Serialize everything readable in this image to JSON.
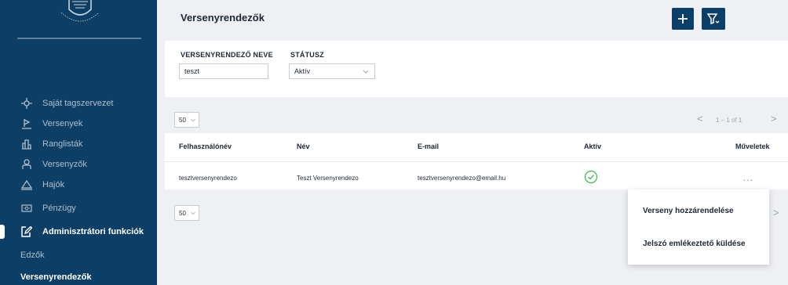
{
  "sidebar": {
    "logo_icon": "club-crest-logo",
    "items": [
      {
        "label": "Saját tagszervezet",
        "icon": "crosshair-icon"
      },
      {
        "label": "Versenyek",
        "icon": "flag-icon"
      },
      {
        "label": "Ranglisták",
        "icon": "bar-chart-icon"
      },
      {
        "label": "Versenyzők",
        "icon": "person-icon"
      },
      {
        "label": "Hajók",
        "icon": "boat-icon"
      },
      {
        "label": "Pénzügy",
        "icon": "wallet-icon"
      },
      {
        "label": "Adminisztrátori funkciók",
        "icon": "edit-icon"
      }
    ],
    "sub_items": [
      {
        "label": "Edzők"
      },
      {
        "label": "Versenyrendezők"
      }
    ]
  },
  "header": {
    "title": "Versenyrendezők",
    "add_icon": "plus-icon",
    "filter_icon": "filter-icon"
  },
  "filters": {
    "name_label": "VERSENYRENDEZŐ NEVE",
    "name_value": "teszt",
    "status_label": "STÁTUSZ",
    "status_value": "Aktív"
  },
  "pagination": {
    "page_size": "50",
    "range": "1 – 1 of 1",
    "prev": "<",
    "next": ">"
  },
  "table": {
    "columns": [
      "Felhasználónév",
      "Név",
      "E-mail",
      "Aktív",
      "Műveletek"
    ],
    "rows": [
      {
        "username": "tesztversenyrendezo",
        "name": "Teszt Versenyrendezo",
        "email": "tesztversenyrendezo@email.hu",
        "active": true,
        "actions": "..."
      }
    ]
  },
  "menu": {
    "items": [
      "Verseny hozzárendelése",
      "Jelszó emlékeztető küldése"
    ]
  },
  "colors": {
    "primary": "#0d3f66",
    "success": "#3bb54a",
    "background": "#eef0f3"
  }
}
